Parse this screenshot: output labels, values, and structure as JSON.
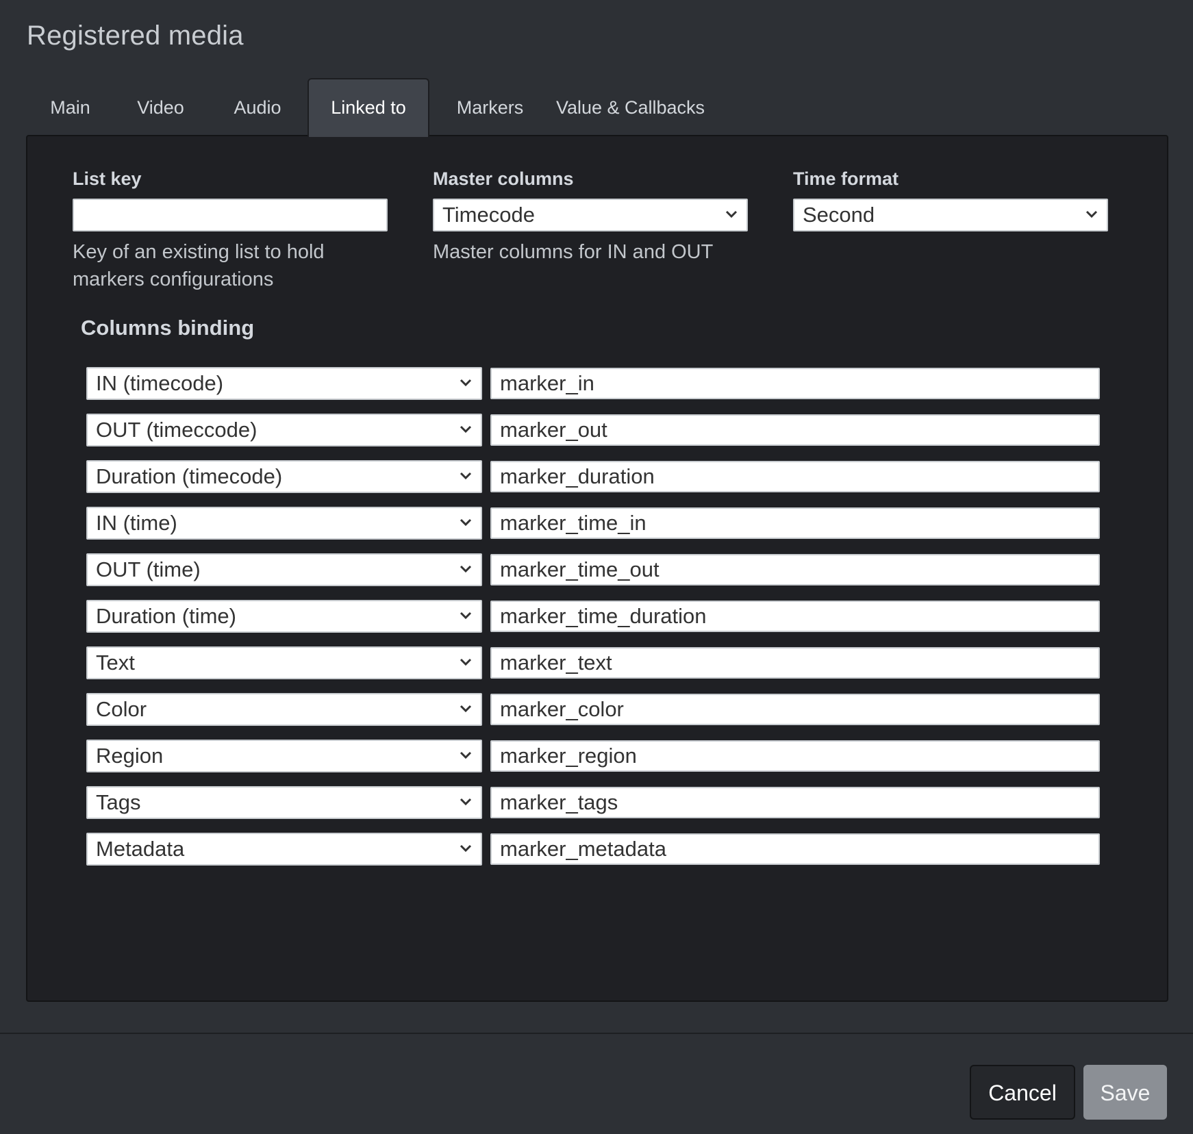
{
  "dialog": {
    "title": "Registered media"
  },
  "tabs": [
    {
      "label": "Main",
      "active": false
    },
    {
      "label": "Video",
      "active": false
    },
    {
      "label": "Audio",
      "active": false
    },
    {
      "label": "Linked to",
      "active": true
    },
    {
      "label": "Markers",
      "active": false
    },
    {
      "label": "Value & Callbacks",
      "active": false
    }
  ],
  "list_key": {
    "label": "List key",
    "value": "",
    "help": "Key of an existing list to hold markers configurations"
  },
  "master_columns": {
    "label": "Master columns",
    "selected": "Timecode",
    "help": "Master columns for IN and OUT"
  },
  "time_format": {
    "label": "Time format",
    "selected": "Second"
  },
  "columns_binding": {
    "title": "Columns binding",
    "rows": [
      {
        "column": "IN (timecode)",
        "field": "marker_in"
      },
      {
        "column": "OUT (timeccode)",
        "field": "marker_out"
      },
      {
        "column": "Duration (timecode)",
        "field": "marker_duration"
      },
      {
        "column": "IN (time)",
        "field": "marker_time_in"
      },
      {
        "column": "OUT (time)",
        "field": "marker_time_out"
      },
      {
        "column": "Duration (time)",
        "field": "marker_time_duration"
      },
      {
        "column": "Text",
        "field": "marker_text"
      },
      {
        "column": "Color",
        "field": "marker_color"
      },
      {
        "column": "Region",
        "field": "marker_region"
      },
      {
        "column": "Tags",
        "field": "marker_tags"
      },
      {
        "column": "Metadata",
        "field": "marker_metadata"
      }
    ]
  },
  "footer": {
    "cancel_label": "Cancel",
    "save_label": "Save"
  },
  "icons": {
    "select_arrow": "chevron-down-icon"
  }
}
